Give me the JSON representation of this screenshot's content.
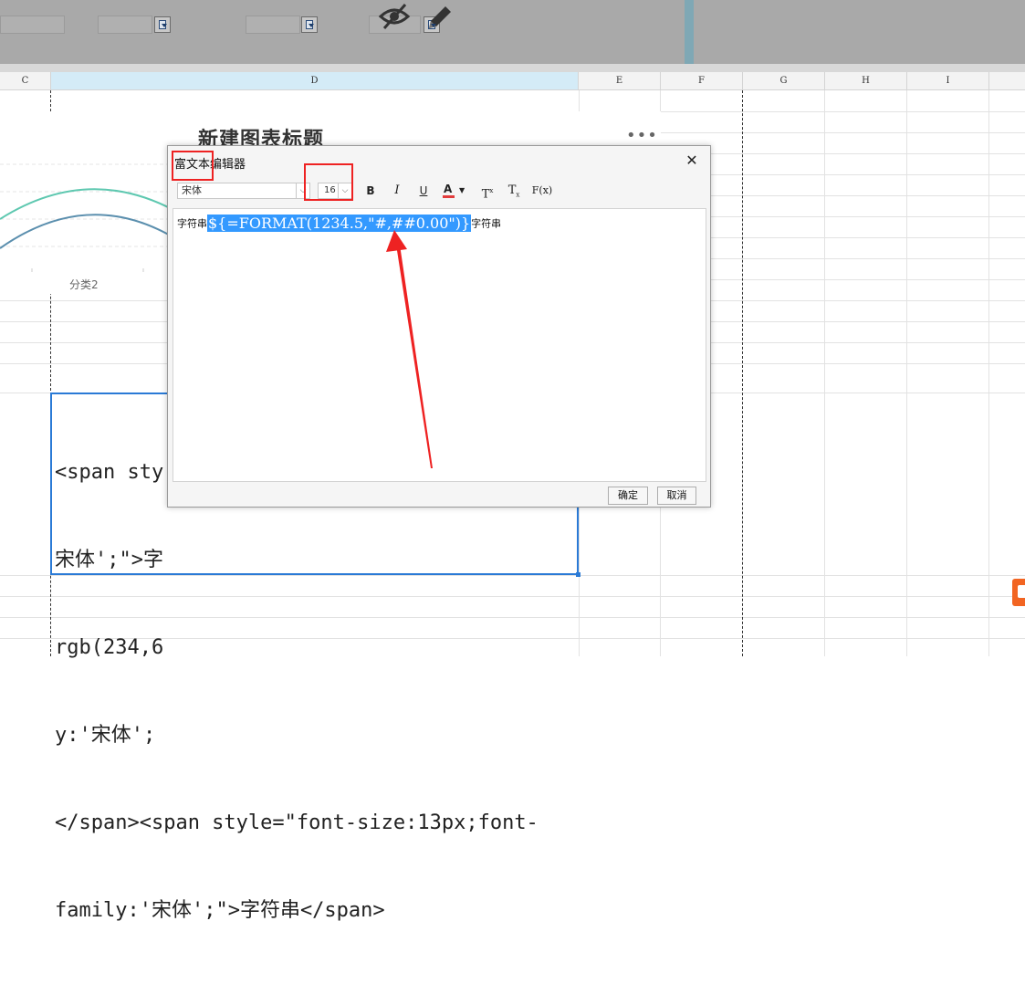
{
  "columns": {
    "C": "C",
    "D": "D",
    "E": "E",
    "F": "F",
    "G": "G",
    "H": "H",
    "I": "I"
  },
  "chart": {
    "title": "新建图表标题",
    "menu": "•••",
    "category_label": "分类2",
    "series_colors": [
      "#5ec8b0",
      "#5b8fae"
    ]
  },
  "cell": {
    "text": "<span style=\"font-size:13px;font-family:'宋体';\">字符串</span><span style=\"font-size:13px;color:rgb(234,6\n宋体';\">字\nrgb(234,6\ny:'宋体';\n</span><span style=\"font-size:13px;font-family:'宋体';\">字符串</span>",
    "visible_lines": [
      "<span sty",
      "宋体';\">字",
      "rgb(234,6",
      "y:'宋体';",
      "</span><span style=\"font-size:13px;font-",
      "family:'宋体';\">字符串</span>"
    ]
  },
  "dialog": {
    "title": "富文本编辑器",
    "close": "✕",
    "font_family": "宋体",
    "font_size": "16",
    "bold": "B",
    "italic": "I",
    "underline": "U",
    "font_color": "A",
    "superscript": "T",
    "subscript": "T",
    "formula": "F(x)",
    "content_prefix": "字符串",
    "content_formula": "${=FORMAT(1234.5,\"#,##0.00\")}",
    "content_suffix": "字符串",
    "ok": "确定",
    "cancel": "取消"
  },
  "colors": {
    "selection": "#3399ff",
    "cell_border": "#2a7ad6",
    "annotation": "#ee2222",
    "selected_column": "#d4ebf7"
  },
  "icons": [
    "eye-slash-icon",
    "pencil-icon",
    "dropdown-icon",
    "close-icon",
    "chevron-down-icon"
  ]
}
